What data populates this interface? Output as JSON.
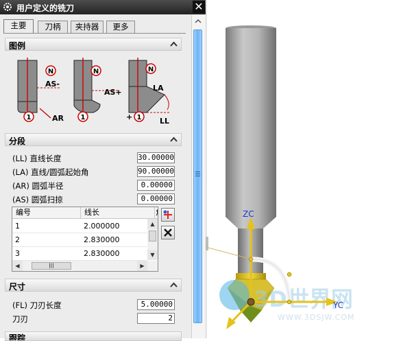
{
  "dialog": {
    "title": "用户定义的铣刀",
    "close_glyph": "✕",
    "tabs": [
      {
        "label": "主要",
        "active": true
      },
      {
        "label": "刀柄",
        "active": false
      },
      {
        "label": "夹持器",
        "active": false
      },
      {
        "label": "更多",
        "active": false
      }
    ],
    "illustration": {
      "header": "图例",
      "labels": {
        "as_minus": "AS-",
        "as_plus": "AS+",
        "ar": "AR",
        "la": "LA",
        "ll": "LL",
        "n": "N",
        "one": "1",
        "plus": "+"
      }
    },
    "segments": {
      "header": "分段",
      "fields": [
        {
          "label": "(LL) 直线长度",
          "value": "30.00000"
        },
        {
          "label": "(LA) 直线/圆弧起始角",
          "value": "90.00000"
        },
        {
          "label": "(AR) 圆弧半径",
          "value": "0.00000"
        },
        {
          "label": "(AS) 圆弧扫掠",
          "value": "0.00000"
        }
      ],
      "table": {
        "columns": [
          "编号",
          "线长",
          "角"
        ],
        "rows": [
          {
            "id": "1",
            "length": "2.000000"
          },
          {
            "id": "2",
            "length": "2.830000"
          },
          {
            "id": "3",
            "length": "2.830000"
          }
        ]
      }
    },
    "dimensions": {
      "header": "尺寸",
      "fields": [
        {
          "label": "(FL) 刀刃长度",
          "value": "5.00000"
        },
        {
          "label": "刀刃",
          "value": "2"
        }
      ]
    },
    "next_section": {
      "header": "跟踪"
    }
  },
  "viewport": {
    "axis_zc": "ZC",
    "axis_yc": "YC",
    "watermark_text": "3D世界网",
    "watermark_url": "WWW.3DSJW.COM"
  }
}
